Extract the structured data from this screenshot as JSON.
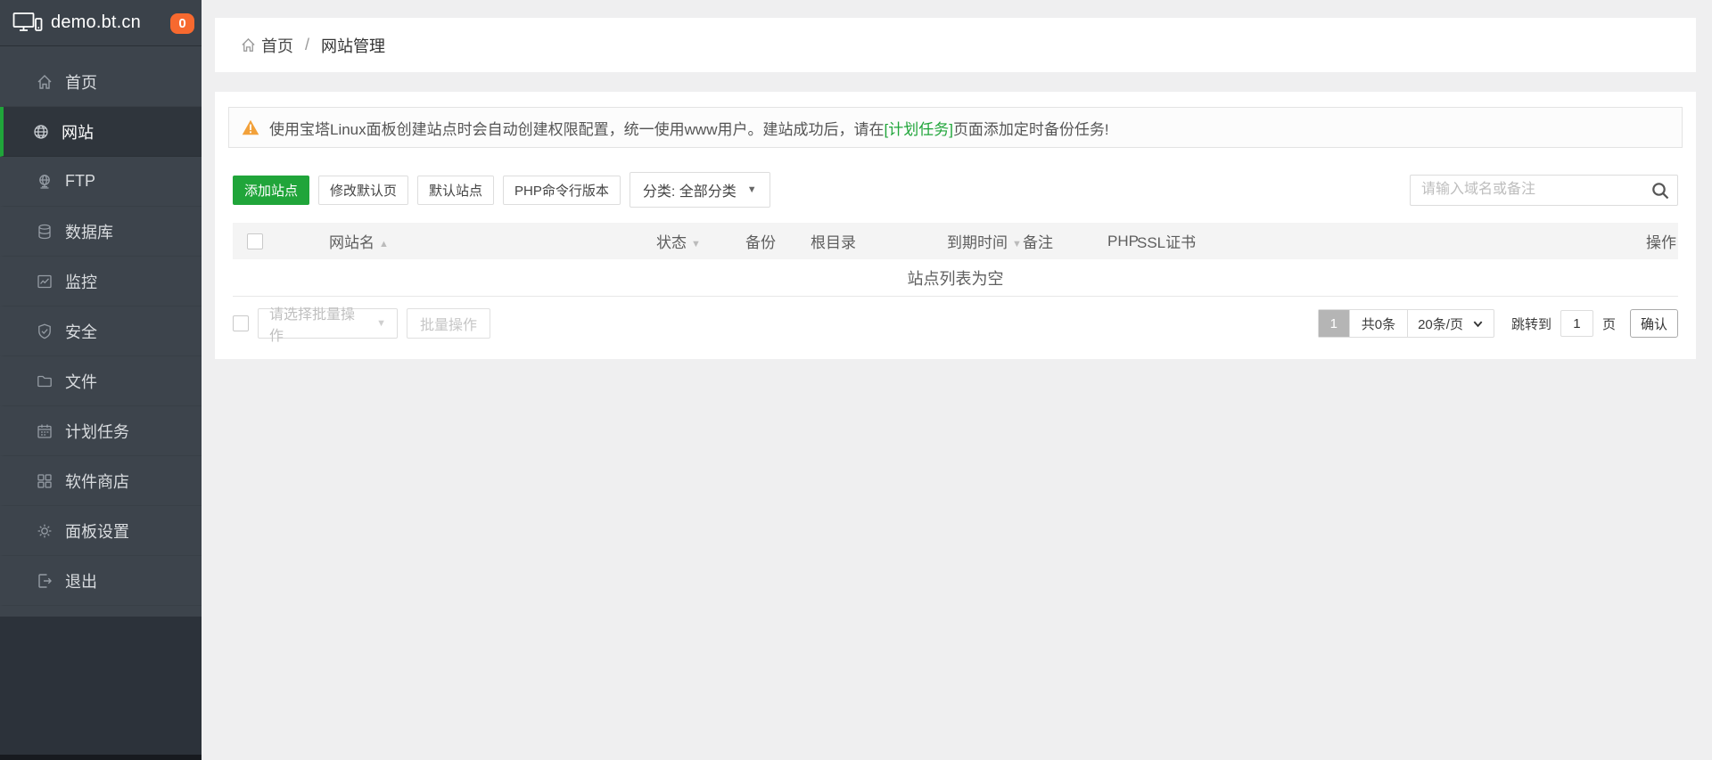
{
  "app": {
    "logo_text": "demo.bt.cn",
    "badge_count": "0"
  },
  "colors": {
    "accent_green": "#20a53a",
    "badge_orange": "#f7692f",
    "sidebar_dark": "#2c323a"
  },
  "icons": {
    "caret_down": "▼",
    "sort_asc": "▲",
    "sort_desc": "▼"
  },
  "sidebar": {
    "items": [
      {
        "id": "home",
        "label": "首页",
        "icon": "home-icon",
        "active": false
      },
      {
        "id": "site",
        "label": "网站",
        "icon": "globe-icon",
        "active": true
      },
      {
        "id": "ftp",
        "label": "FTP",
        "icon": "ftp-icon",
        "active": false
      },
      {
        "id": "database",
        "label": "数据库",
        "icon": "database-icon",
        "active": false
      },
      {
        "id": "monitor",
        "label": "监控",
        "icon": "monitor-icon",
        "active": false
      },
      {
        "id": "security",
        "label": "安全",
        "icon": "shield-icon",
        "active": false
      },
      {
        "id": "files",
        "label": "文件",
        "icon": "folder-icon",
        "active": false
      },
      {
        "id": "cron",
        "label": "计划任务",
        "icon": "calendar-icon",
        "active": false
      },
      {
        "id": "soft",
        "label": "软件商店",
        "icon": "grid-icon",
        "active": false
      },
      {
        "id": "config",
        "label": "面板设置",
        "icon": "gear-icon",
        "active": false
      },
      {
        "id": "logout",
        "label": "退出",
        "icon": "logout-icon",
        "active": false
      }
    ]
  },
  "breadcrumb": {
    "home": "首页",
    "separator": "/",
    "current": "网站管理"
  },
  "alert": {
    "text_before": "使用宝塔Linux面板创建站点时会自动创建权限配置，统一使用www用户。建站成功后，请在",
    "link_text": "[计划任务]",
    "text_after": "页面添加定时备份任务!"
  },
  "toolbar": {
    "buttons": [
      {
        "name": "add-site-button",
        "label": "添加站点",
        "primary": true
      },
      {
        "name": "modify-default-page-button",
        "label": "修改默认页",
        "primary": false
      },
      {
        "name": "default-site-button",
        "label": "默认站点",
        "primary": false
      },
      {
        "name": "php-cli-version-button",
        "label": "PHP命令行版本",
        "primary": false
      }
    ],
    "category_label": "分类: 全部分类",
    "search_placeholder": "请输入域名或备注"
  },
  "table": {
    "columns": [
      {
        "id": "site-name",
        "label": "网站名",
        "sort": "asc",
        "sortable": true
      },
      {
        "id": "status",
        "label": "状态",
        "sort": "desc",
        "sortable": true
      },
      {
        "id": "backup",
        "label": "备份",
        "sort": null,
        "sortable": false
      },
      {
        "id": "root-dir",
        "label": "根目录",
        "sort": null,
        "sortable": false
      },
      {
        "id": "expire-time",
        "label": "到期时间",
        "sort": "desc",
        "sortable": true
      },
      {
        "id": "note",
        "label": "备注",
        "sort": null,
        "sortable": false
      },
      {
        "id": "php",
        "label": "PHP",
        "sort": null,
        "sortable": false
      },
      {
        "id": "ssl",
        "label": "SSL证书",
        "sort": null,
        "sortable": false
      },
      {
        "id": "actions",
        "label": "操作",
        "sort": null,
        "sortable": false
      }
    ],
    "empty_text": "站点列表为空"
  },
  "batch": {
    "select_label": "请选择批量操作",
    "button_label": "批量操作"
  },
  "pagination": {
    "page": "1",
    "total_label": "共0条",
    "page_size_value": "20条/页",
    "jump_label": "跳转到",
    "jump_value": "1",
    "page_unit": "页",
    "confirm_label": "确认"
  }
}
